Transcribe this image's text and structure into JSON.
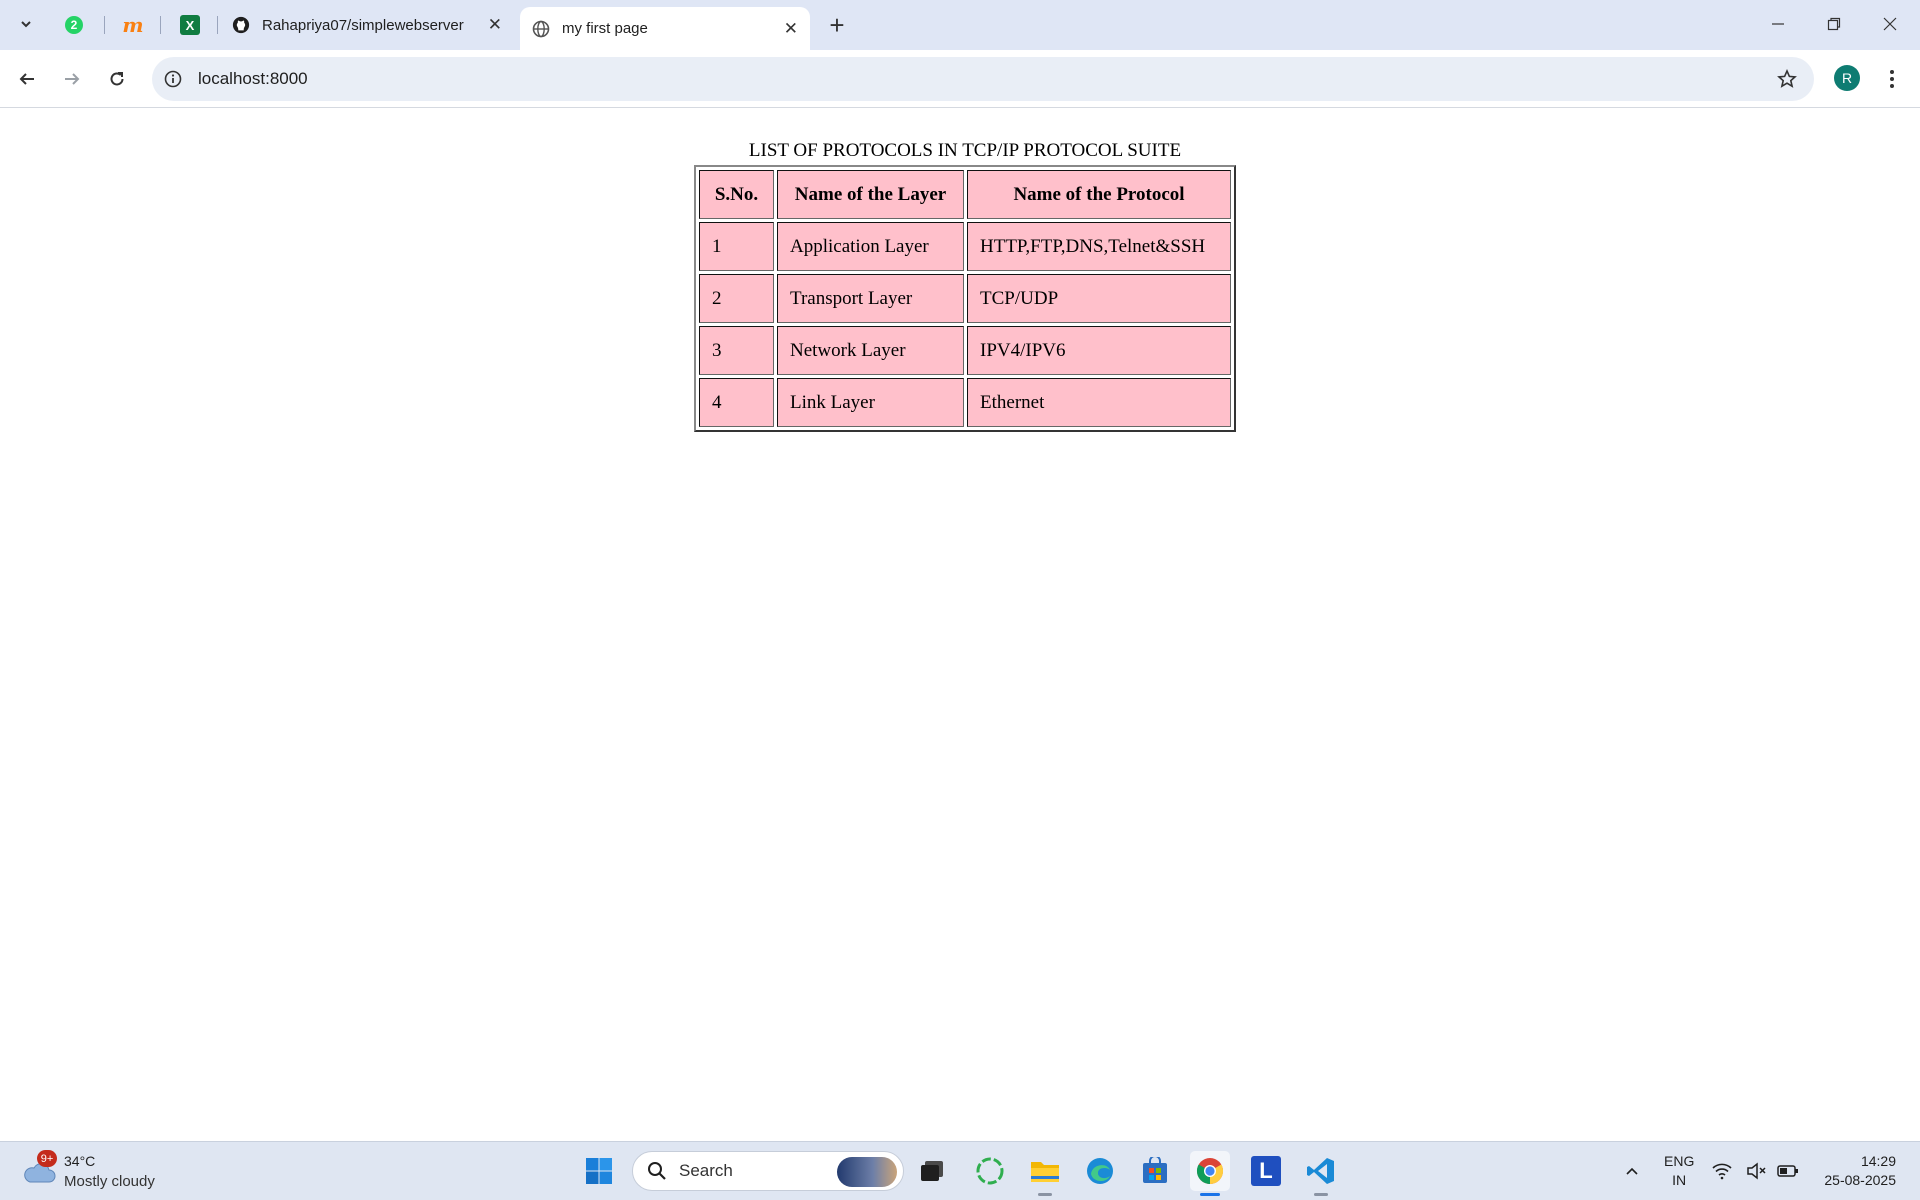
{
  "browser": {
    "tabs": [
      {
        "title": "Rahapriya07/simplewebserver"
      },
      {
        "title": "my first page"
      }
    ],
    "pinned": [
      {
        "label": "2"
      },
      {
        "label": "m"
      },
      {
        "label": "X"
      }
    ],
    "address": "localhost:8000",
    "profile_initial": "R"
  },
  "page": {
    "table_caption": "LIST OF PROTOCOLS IN TCP/IP PROTOCOL SUITE",
    "headers": [
      "S.No.",
      "Name of the Layer",
      "Name of the Protocol"
    ],
    "rows": [
      [
        "1",
        "Application Layer",
        "HTTP,FTP,DNS,Telnet&SSH"
      ],
      [
        "2",
        "Transport Layer",
        "TCP/UDP"
      ],
      [
        "3",
        "Network Layer",
        "IPV4/IPV6"
      ],
      [
        "4",
        "Link Layer",
        "Ethernet"
      ]
    ],
    "cell_color": "#ffc0cb"
  },
  "taskbar": {
    "weather": {
      "badge": "9+",
      "temp": "34°C",
      "condition": "Mostly cloudy"
    },
    "search_label": "Search",
    "language": {
      "line1": "ENG",
      "line2": "IN"
    },
    "clock": {
      "time": "14:29",
      "date": "25-08-2025"
    },
    "pinned_apps": [
      "task-view-icon",
      "copilot-icon",
      "file-explorer-icon",
      "edge-icon",
      "store-icon",
      "chrome-icon",
      "l-app-icon",
      "vscode-icon"
    ]
  }
}
